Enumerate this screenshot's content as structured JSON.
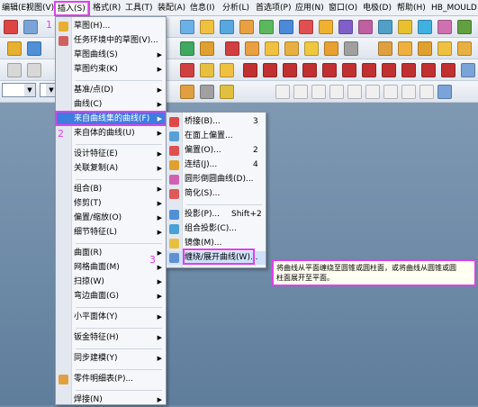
{
  "menubar": {
    "items": [
      "编辑(E)",
      "视图(V)",
      "插入(S)",
      "格式(R)",
      "工具(T)",
      "装配(A)",
      "信息(I)",
      "分析(L)",
      "首选项(P)",
      "应用(N)",
      "窗口(O)",
      "电极(D)",
      "帮助(H)",
      "HB_MOULD"
    ]
  },
  "insert_menu": {
    "items": [
      {
        "label": "草图(H)...",
        "submenu": false
      },
      {
        "label": "任务环境中的草图(V)...",
        "submenu": false
      },
      {
        "label": "草图曲线(S)",
        "submenu": true
      },
      {
        "label": "草图约束(K)",
        "submenu": true
      },
      {
        "label": "基准/点(D)",
        "submenu": true
      },
      {
        "label": "曲线(C)",
        "submenu": true
      },
      {
        "label": "来自曲线集的曲线(F)",
        "submenu": true,
        "selected": true
      },
      {
        "label": "来自体的曲线(U)",
        "submenu": true
      },
      {
        "label": "设计特征(E)",
        "submenu": true
      },
      {
        "label": "关联复制(A)",
        "submenu": true
      },
      {
        "label": "组合(B)",
        "submenu": true
      },
      {
        "label": "修剪(T)",
        "submenu": true
      },
      {
        "label": "偏置/缩放(O)",
        "submenu": true
      },
      {
        "label": "细节特征(L)",
        "submenu": true
      },
      {
        "label": "曲面(R)",
        "submenu": true
      },
      {
        "label": "网格曲面(M)",
        "submenu": true
      },
      {
        "label": "扫掠(W)",
        "submenu": true
      },
      {
        "label": "弯边曲面(G)",
        "submenu": true
      },
      {
        "label": "小平面体(Y)",
        "submenu": true
      },
      {
        "label": "钣金特征(H)",
        "submenu": true
      },
      {
        "label": "同步建模(Y)",
        "submenu": true
      },
      {
        "label": "零件明细表(P)...",
        "submenu": false
      },
      {
        "label": "焊接(N)",
        "submenu": true
      }
    ]
  },
  "curve_submenu": {
    "items": [
      {
        "label": "桥接(B)...",
        "shortcut": "3"
      },
      {
        "label": "在面上偏置...",
        "shortcut": ""
      },
      {
        "label": "偏置(O)...",
        "shortcut": "2"
      },
      {
        "label": "连结(J)...",
        "shortcut": "4"
      },
      {
        "label": "圆形倒圆曲线(D)...",
        "shortcut": ""
      },
      {
        "label": "简化(S)...",
        "shortcut": ""
      },
      {
        "label": "投影(P)...",
        "shortcut": "Shift+2"
      },
      {
        "label": "组合投影(C)...",
        "shortcut": ""
      },
      {
        "label": "镜像(M)...",
        "shortcut": ""
      },
      {
        "label": "缠绕/展开曲线(W)...",
        "shortcut": "",
        "selected": true
      }
    ]
  },
  "steps": [
    "1",
    "2",
    "3"
  ],
  "tooltip": {
    "text": "将曲线从平面缠绕至圆锥或圆柱面，或将曲线从圆锥或圆\n柱面展开至平面。"
  },
  "colors": {
    "highlight": "#3d7de0",
    "annotation": "#e040e8",
    "menu_bg": "#f5f7fb"
  }
}
